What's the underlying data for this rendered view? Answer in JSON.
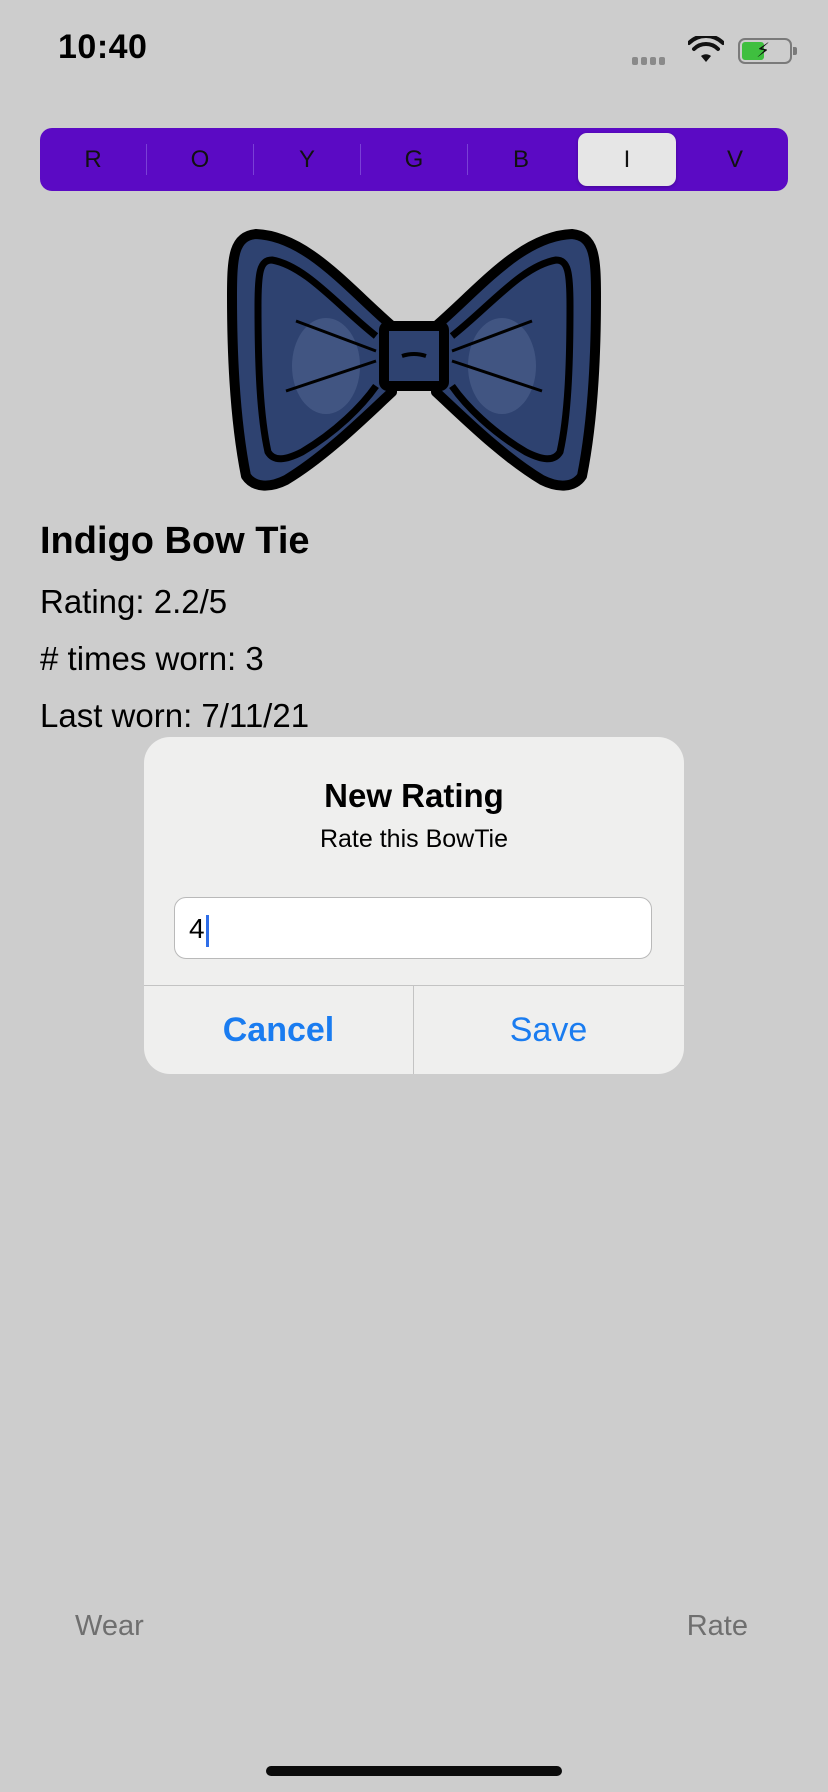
{
  "status_bar": {
    "time": "10:40"
  },
  "segments": [
    {
      "label": "R",
      "selected": false
    },
    {
      "label": "O",
      "selected": false
    },
    {
      "label": "Y",
      "selected": false
    },
    {
      "label": "G",
      "selected": false
    },
    {
      "label": "B",
      "selected": false
    },
    {
      "label": "I",
      "selected": true
    },
    {
      "label": "V",
      "selected": false
    }
  ],
  "colors": {
    "segment_background": "#5b0ac4",
    "bowtie_fill": "#2e4270",
    "accent": "#1a7cf0"
  },
  "item": {
    "title": "Indigo Bow Tie",
    "rating": "Rating: 2.2/5",
    "times_worn": "# times worn: 3",
    "last_worn": "Last worn: 7/11/21",
    "image_icon": "bowtie-icon"
  },
  "alert": {
    "title": "New Rating",
    "message": "Rate this BowTie",
    "input_value": "4",
    "cancel_label": "Cancel",
    "save_label": "Save"
  },
  "tabs": {
    "wear": "Wear",
    "rate": "Rate"
  }
}
